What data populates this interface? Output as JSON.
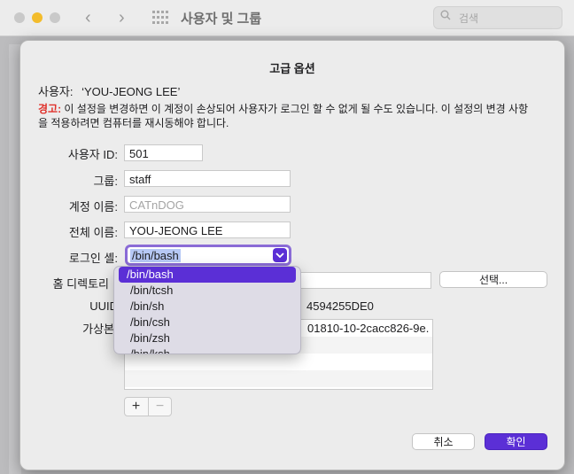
{
  "window": {
    "title": "사용자 및 그룹",
    "search_placeholder": "검색"
  },
  "sheet": {
    "title": "고급 옵션",
    "user_label": "사용자:",
    "user_value": "‘YOU-JEONG LEE’",
    "warning_label": "경고:",
    "warning_text": "이 설정을 변경하면 이 계정이 손상되어 사용자가 로그인 할 수 없게 될 수도 있습니다. 이 설정의 변경 사항을 적용하려면 컴퓨터를 재시동해야 합니다.",
    "fields": {
      "user_id": {
        "label": "사용자 ID:",
        "value": "501"
      },
      "group": {
        "label": "그룹:",
        "value": "staff"
      },
      "account_name": {
        "label": "계정 이름:",
        "value": "CATnDOG"
      },
      "full_name": {
        "label": "전체 이름:",
        "value": "YOU-JEONG LEE"
      },
      "login_shell": {
        "label": "로그인 셸:",
        "value": "/bin/bash"
      },
      "home_dir": {
        "label": "홈 디렉토리",
        "button": "선택..."
      },
      "uuid": {
        "label": "UUID",
        "value": "4594255DE0"
      },
      "alias": {
        "label": "가상본",
        "value": "01810-10-2cacc826-9e."
      }
    },
    "add_button": "+",
    "remove_button": "−",
    "cancel": "취소",
    "ok": "확인"
  },
  "shell_menu": {
    "options": [
      "/bin/bash",
      "/bin/tcsh",
      "/bin/sh",
      "/bin/csh",
      "/bin/zsh",
      "/bin/ksh"
    ],
    "selected": "/bin/bash"
  },
  "colors": {
    "accent": "#5b2fd6",
    "warning": "#e0302a",
    "focus_ring": "#8a6bd6"
  }
}
